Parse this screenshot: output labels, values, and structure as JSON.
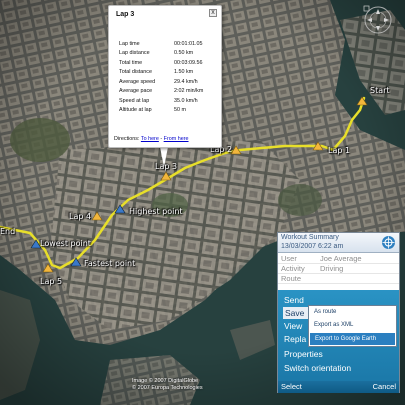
{
  "map": {
    "pins": [
      {
        "id": "start",
        "label": "Start"
      },
      {
        "id": "lap1",
        "label": "Lap 1"
      },
      {
        "id": "lap2",
        "label": "Lap 2"
      },
      {
        "id": "lap3",
        "label": "Lap 3"
      },
      {
        "id": "lap4",
        "label": "Lap 4"
      },
      {
        "id": "lap5",
        "label": "Lap 5"
      },
      {
        "id": "highest",
        "label": "Highest point"
      },
      {
        "id": "lowest",
        "label": "Lowest point"
      },
      {
        "id": "fastest",
        "label": "Fastest point"
      },
      {
        "id": "end",
        "label": "End"
      }
    ],
    "route_color": "#e8df2a",
    "pin_color": "#f2b63c"
  },
  "balloon": {
    "title": "Lap 3",
    "close": "x",
    "stats": [
      {
        "label": "Lap time",
        "value": "00:01:01.05"
      },
      {
        "label": "Lap distance",
        "value": "0.50 km"
      },
      {
        "label": "Total time",
        "value": "00:03:09.56"
      },
      {
        "label": "Total distance",
        "value": "1.50 km"
      },
      {
        "label": "Average speed",
        "value": "29.4 km/h"
      },
      {
        "label": "Average pace",
        "value": "2:02 min/km"
      },
      {
        "label": "Speed at lap",
        "value": "35.0 km/h"
      },
      {
        "label": "Altitude at lap",
        "value": "50 m"
      }
    ],
    "directions_prefix": "Directions:",
    "to_here": "To here",
    "separator": "-",
    "from_here": "From here"
  },
  "phone": {
    "title": "Workout Summary",
    "datetime": "13/03/2007 6:22 am",
    "rows": [
      {
        "key": "User",
        "value": "Joe Average"
      },
      {
        "key": "Activity",
        "value": "Driving"
      },
      {
        "key": "Route",
        "value": ""
      }
    ],
    "menu": [
      "Send",
      "Save",
      "View",
      "Repla",
      "Properties",
      "Switch orientation"
    ],
    "selected_menu": "Save",
    "submenu": [
      "As route",
      "Export as XML",
      "Export to Google Earth"
    ],
    "selected_submenu": "Export to Google Earth",
    "left_softkey": "Select",
    "right_softkey": "Cancel",
    "accent": "#1a76a6"
  },
  "copyright": {
    "line1": "Image © 2007 DigitalGlobe",
    "line2": "© 2007 Europa Technologies"
  }
}
